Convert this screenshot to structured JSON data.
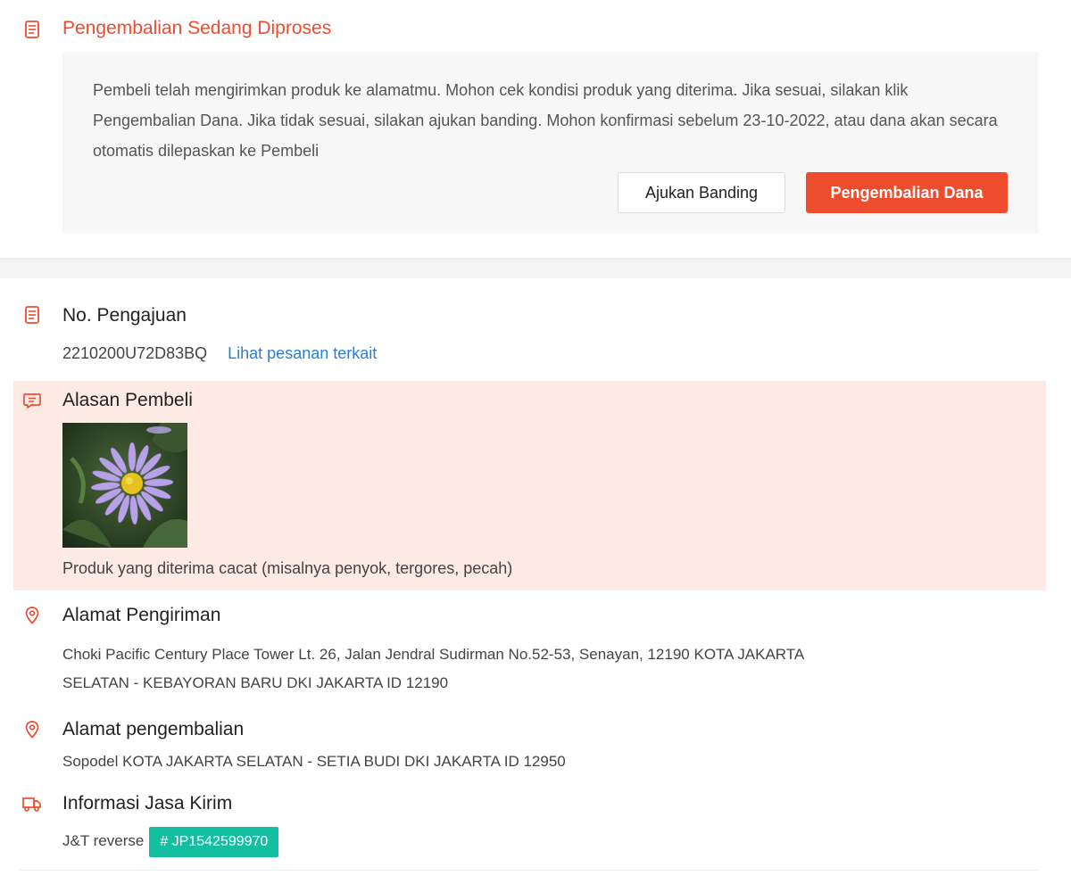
{
  "status": {
    "title": "Pengembalian Sedang Diproses",
    "message": "Pembeli telah mengirimkan produk ke alamatmu. Mohon cek kondisi produk yang diterima. Jika sesuai, silakan klik Pengembalian Dana. Jika tidak sesuai, silakan ajukan banding. Mohon konfirmasi sebelum 23-10-2022, atau dana akan secara otomatis dilepaskan ke Pembeli",
    "appeal_label": "Ajukan Banding",
    "refund_label": "Pengembalian Dana",
    "icon": "document-icon"
  },
  "request": {
    "title": "No. Pengajuan",
    "number": "2210200U72D83BQ",
    "link_label": "Lihat pesanan terkait",
    "icon": "document-icon"
  },
  "reason": {
    "title": "Alasan Pembeli",
    "description": "Produk yang diterima cacat (misalnya penyok, tergores, pecah)",
    "icon": "chat-bubble-icon"
  },
  "shipping_address": {
    "title": "Alamat Pengiriman",
    "line1": "Choki Pacific Century Place Tower Lt. 26, Jalan Jendral Sudirman No.52-53, Senayan, 12190 KOTA JAKARTA",
    "line2": "SELATAN - KEBAYORAN BARU DKI JAKARTA ID 12190",
    "icon": "location-pin-icon"
  },
  "return_address": {
    "title": "Alamat pengembalian",
    "text": "Sopodel KOTA JAKARTA SELATAN - SETIA BUDI DKI JAKARTA ID 12950",
    "icon": "location-pin-icon"
  },
  "courier": {
    "title": "Informasi Jasa Kirim",
    "name": "J&T reverse",
    "tracking": "# JP1542599970",
    "icon": "truck-icon"
  },
  "colors": {
    "accent": "#ee4d2d",
    "reason_background": "#fdeae5",
    "tracking_badge": "#14bfa1",
    "link": "#2d7dd2"
  }
}
